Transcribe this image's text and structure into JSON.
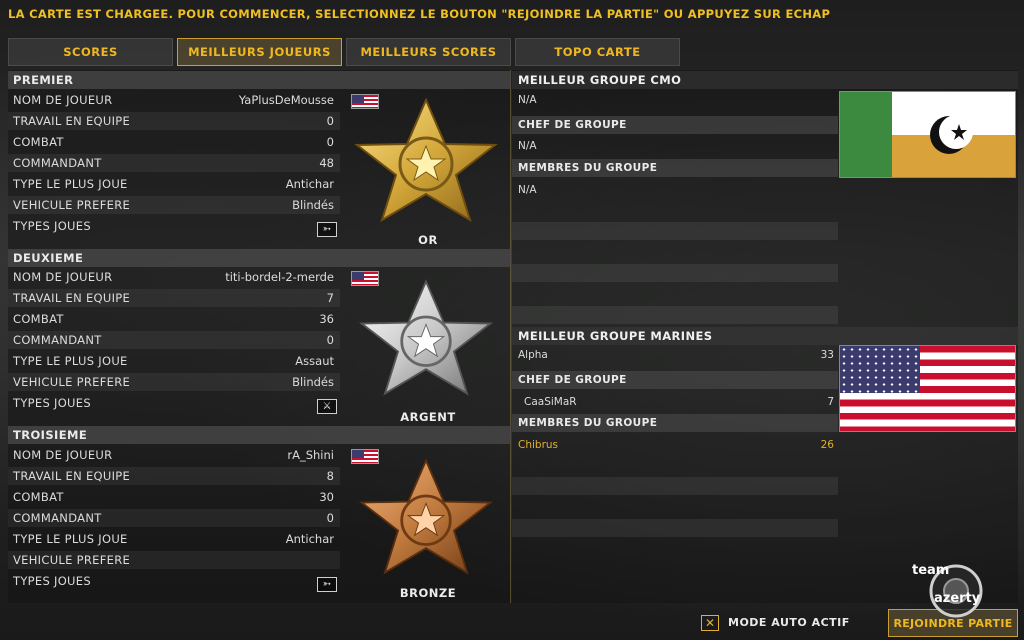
{
  "notice": "LA CARTE EST CHARGEE. POUR COMMENCER, SELECTIONNEZ LE BOUTON \"REJOINDRE LA PARTIE\" OU APPUYEZ SUR ECHAP",
  "tabs": [
    {
      "label": "SCORES",
      "active": false
    },
    {
      "label": "MEILLEURS JOUEURS",
      "active": true
    },
    {
      "label": "MEILLEURS SCORES",
      "active": false
    },
    {
      "label": "TOPO CARTE",
      "active": false
    }
  ],
  "players": [
    {
      "rank": "PREMIER",
      "medal": "OR",
      "rows": [
        {
          "label": "NOM DE JOUEUR",
          "value": "YaPlusDeMousse"
        },
        {
          "label": "TRAVAIL EN EQUIPE",
          "value": "0"
        },
        {
          "label": "COMBAT",
          "value": "0"
        },
        {
          "label": "COMMANDANT",
          "value": "48"
        },
        {
          "label": "TYPE LE PLUS JOUE",
          "value": "Antichar"
        },
        {
          "label": "VEHICULE PREFERE",
          "value": "Blindés"
        },
        {
          "label": "TYPES JOUES",
          "value": ""
        }
      ]
    },
    {
      "rank": "DEUXIEME",
      "medal": "ARGENT",
      "rows": [
        {
          "label": "NOM DE JOUEUR",
          "value": "titi-bordel-2-merde"
        },
        {
          "label": "TRAVAIL EN EQUIPE",
          "value": "7"
        },
        {
          "label": "COMBAT",
          "value": "36"
        },
        {
          "label": "COMMANDANT",
          "value": "0"
        },
        {
          "label": "TYPE LE PLUS JOUE",
          "value": "Assaut"
        },
        {
          "label": "VEHICULE PREFERE",
          "value": "Blindés"
        },
        {
          "label": "TYPES JOUES",
          "value": ""
        }
      ]
    },
    {
      "rank": "TROISIEME",
      "medal": "BRONZE",
      "rows": [
        {
          "label": "NOM DE JOUEUR",
          "value": "rA_Shini"
        },
        {
          "label": "TRAVAIL EN EQUIPE",
          "value": "8"
        },
        {
          "label": "COMBAT",
          "value": "30"
        },
        {
          "label": "COMMANDANT",
          "value": "0"
        },
        {
          "label": "TYPE LE PLUS JOUE",
          "value": "Antichar"
        },
        {
          "label": "VEHICULE PREFERE",
          "value": ""
        },
        {
          "label": "TYPES JOUES",
          "value": ""
        }
      ]
    }
  ],
  "cmo": {
    "title": "MEILLEUR GROUPE CMO",
    "group_name": "N/A",
    "leader_head": "CHEF DE GROUPE",
    "leader": "N/A",
    "members_head": "MEMBRES DU GROUPE",
    "member": "N/A"
  },
  "marines": {
    "title": "MEILLEUR GROUPE MARINES",
    "group_name": "Alpha",
    "group_score": "33",
    "leader_head": "CHEF DE GROUPE",
    "leader": "CaaSiMaR",
    "leader_score": "7",
    "members_head": "MEMBRES DU GROUPE",
    "member": "Chibrus",
    "member_score": "26"
  },
  "bottom": {
    "auto_label": "MODE AUTO ACTIF",
    "auto_mark": "✕",
    "join_label": "REJOINDRE PARTIE"
  },
  "logo": {
    "top": "team",
    "bottom": "azerty"
  },
  "colors": {
    "accent": "#f0b820",
    "member_highlight": "#e0b030",
    "gold": "#d4a83a",
    "silver": "#c8c8c8",
    "bronze": "#c07a3e"
  }
}
